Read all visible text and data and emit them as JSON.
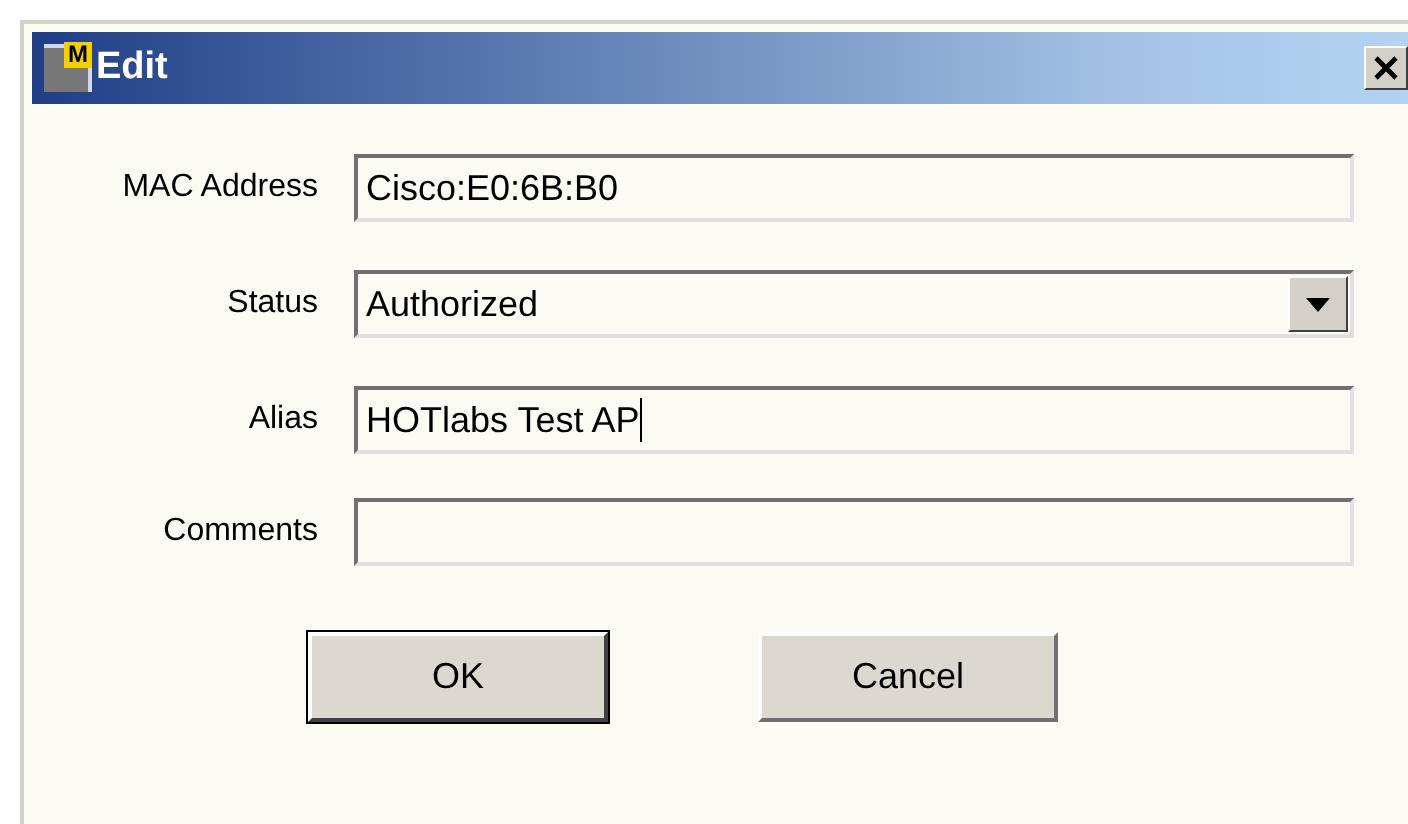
{
  "window": {
    "title": "Edit",
    "icon_letter": "M"
  },
  "fields": [
    {
      "label": "MAC Address",
      "kind": "text",
      "value": "Cisco:E0:6B:B0",
      "focused": false
    },
    {
      "label": "Status",
      "kind": "dropdown",
      "value": "Authorized",
      "focused": false
    },
    {
      "label": "Alias",
      "kind": "text",
      "value": "HOTlabs Test AP",
      "focused": true
    },
    {
      "label": "Comments",
      "kind": "text",
      "focused": false
    }
  ],
  "buttons": [
    {
      "label": "OK",
      "default": true
    },
    {
      "label": "Cancel",
      "default": false
    }
  ]
}
